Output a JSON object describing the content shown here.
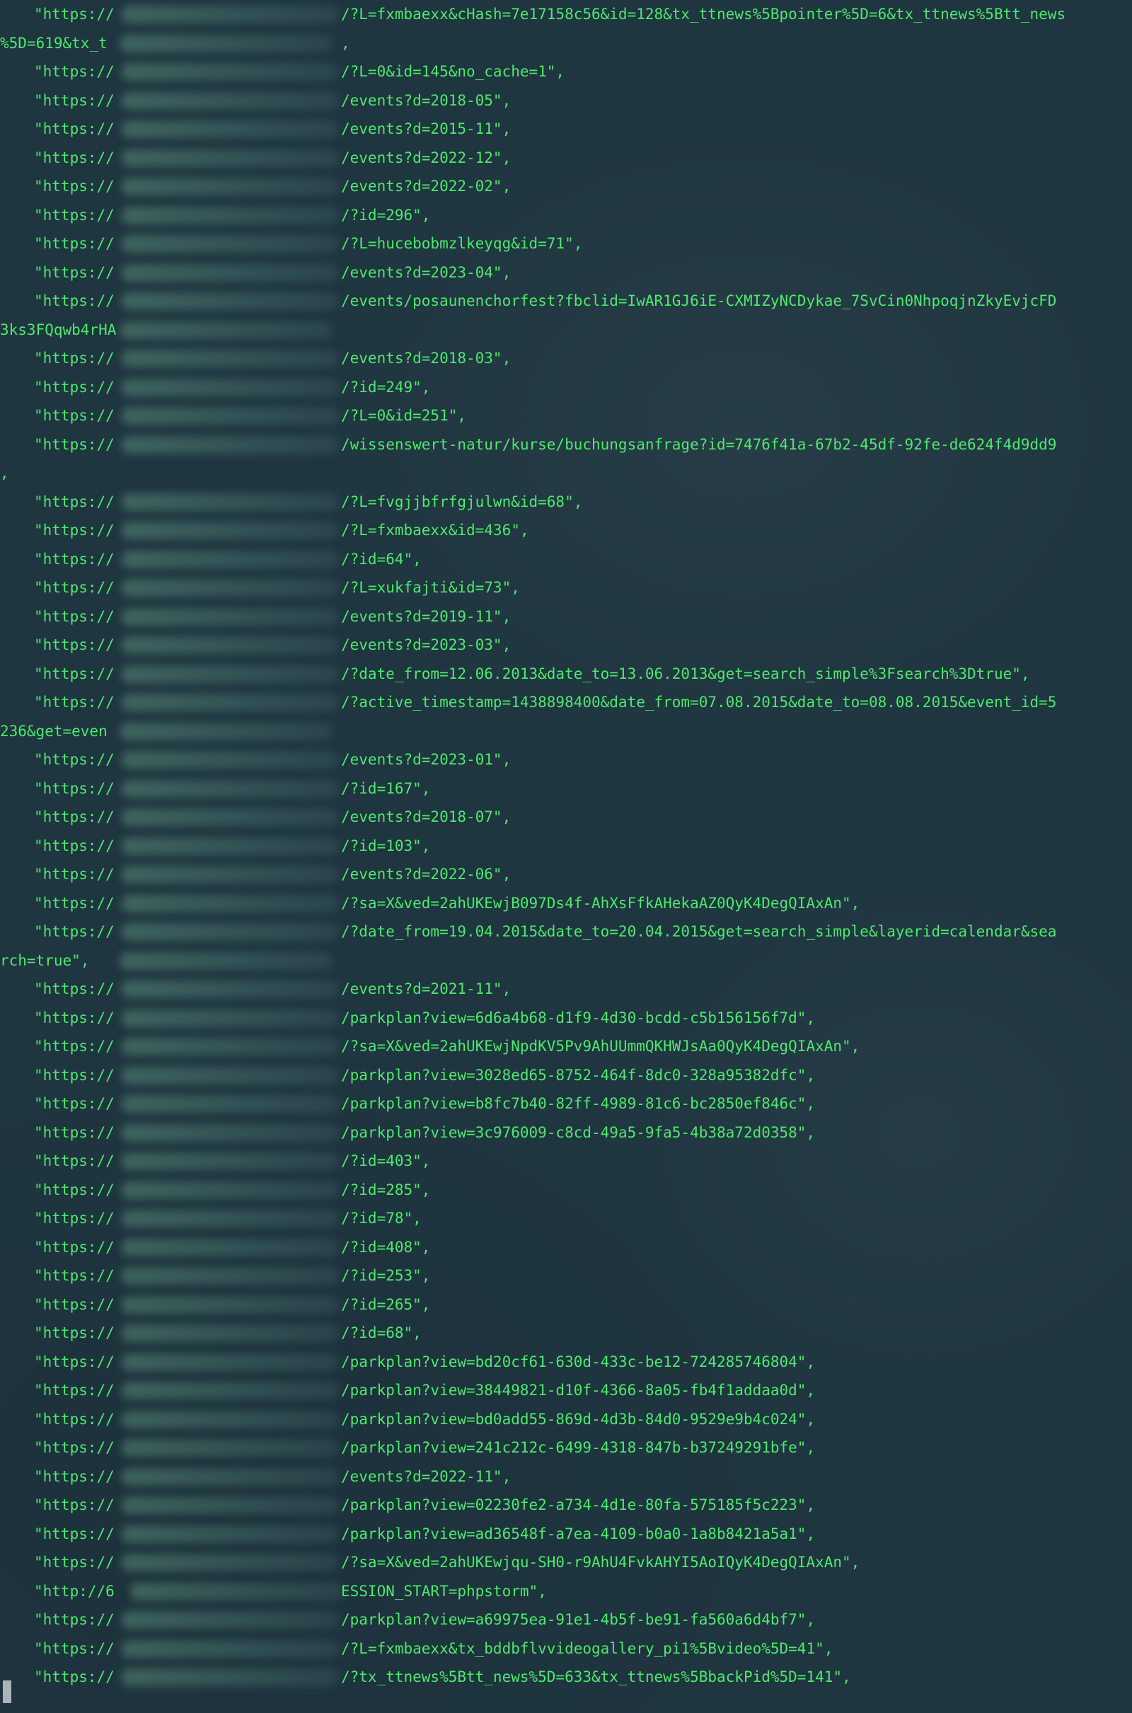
{
  "terminal": {
    "lines": [
      {
        "prefix": "\"https://",
        "path": "/?L=fxmbaexx&cHash=7e17158c56&id=128&tx_ttnews%5Bpointer%5D=6&tx_ttnews%5Btt_news"
      },
      {
        "tail": "%5D=619&tx_t",
        "tail_end": ","
      },
      {
        "prefix": "\"https://",
        "path": "/?L=0&id=145&no_cache=1\","
      },
      {
        "prefix": "\"https://",
        "path": "/events?d=2018-05\","
      },
      {
        "prefix": "\"https://",
        "path": "/events?d=2015-11\","
      },
      {
        "prefix": "\"https://",
        "path": "/events?d=2022-12\","
      },
      {
        "prefix": "\"https://",
        "path": "/events?d=2022-02\","
      },
      {
        "prefix": "\"https://",
        "path": "/?id=296\","
      },
      {
        "prefix": "\"https://",
        "path": "/?L=hucebobmzlkeyqg&id=71\","
      },
      {
        "prefix": "\"https://",
        "path": "/events?d=2023-04\","
      },
      {
        "prefix": "\"https://",
        "path": "/events/posaunenchorfest?fbclid=IwAR1GJ6iE-CXMIZyNCDykae_7SvCin0NhpoqjnZkyEvjcFD"
      },
      {
        "tail": "3ks3FQqwb4rHA",
        "tail_end": ""
      },
      {
        "prefix": "\"https://",
        "path": "/events?d=2018-03\","
      },
      {
        "prefix": "\"https://",
        "path": "/?id=249\","
      },
      {
        "prefix": "\"https://",
        "path": "/?L=0&id=251\","
      },
      {
        "prefix": "\"https://",
        "path": "/wissenswert-natur/kurse/buchungsanfrage?id=7476f41a-67b2-45df-92fe-de624f4d9dd9"
      },
      {
        "tail": ",",
        "tail_end": ""
      },
      {
        "prefix": "\"https://",
        "path": "/?L=fvgjjbfrfgjulwn&id=68\","
      },
      {
        "prefix": "\"https://",
        "path": "/?L=fxmbaexx&id=436\","
      },
      {
        "prefix": "\"https://",
        "path": "/?id=64\","
      },
      {
        "prefix": "\"https://",
        "path": "/?L=xukfajti&id=73\","
      },
      {
        "prefix": "\"https://",
        "path": "/events?d=2019-11\","
      },
      {
        "prefix": "\"https://",
        "path": "/events?d=2023-03\","
      },
      {
        "prefix": "\"https://",
        "path": "/?date_from=12.06.2013&date_to=13.06.2013&get=search_simple%3Fsearch%3Dtrue\","
      },
      {
        "prefix": "\"https://",
        "path": "/?active_timestamp=1438898400&date_from=07.08.2015&date_to=08.08.2015&event_id=5"
      },
      {
        "tail": "236&get=even",
        "tail_end": ""
      },
      {
        "prefix": "\"https://",
        "path": "/events?d=2023-01\","
      },
      {
        "prefix": "\"https://",
        "path": "/?id=167\","
      },
      {
        "prefix": "\"https://",
        "path": "/events?d=2018-07\","
      },
      {
        "prefix": "\"https://",
        "path": "/?id=103\","
      },
      {
        "prefix": "\"https://",
        "path": "/events?d=2022-06\","
      },
      {
        "prefix": "\"https://",
        "path": "/?sa=X&ved=2ahUKEwjB097Ds4f-AhXsFfkAHekaAZ0QyK4DegQIAxAn\","
      },
      {
        "prefix": "\"https://",
        "path": "/?date_from=19.04.2015&date_to=20.04.2015&get=search_simple&layerid=calendar&sea"
      },
      {
        "tail": "rch=true\",",
        "tail_end": ""
      },
      {
        "prefix": "\"https://",
        "path": "/events?d=2021-11\","
      },
      {
        "prefix": "\"https://",
        "path": "/parkplan?view=6d6a4b68-d1f9-4d30-bcdd-c5b156156f7d\","
      },
      {
        "prefix": "\"https://",
        "path": "/?sa=X&ved=2ahUKEwjNpdKV5Pv9AhUUmmQKHWJsAa0QyK4DegQIAxAn\","
      },
      {
        "prefix": "\"https://",
        "path": "/parkplan?view=3028ed65-8752-464f-8dc0-328a95382dfc\","
      },
      {
        "prefix": "\"https://",
        "path": "/parkplan?view=b8fc7b40-82ff-4989-81c6-bc2850ef846c\","
      },
      {
        "prefix": "\"https://",
        "path": "/parkplan?view=3c976009-c8cd-49a5-9fa5-4b38a72d0358\","
      },
      {
        "prefix": "\"https://",
        "path": "/?id=403\","
      },
      {
        "prefix": "\"https://",
        "path": "/?id=285\","
      },
      {
        "prefix": "\"https://",
        "path": "/?id=78\","
      },
      {
        "prefix": "\"https://",
        "path": "/?id=408\","
      },
      {
        "prefix": "\"https://",
        "path": "/?id=253\","
      },
      {
        "prefix": "\"https://",
        "path": "/?id=265\","
      },
      {
        "prefix": "\"https://",
        "path": "/?id=68\","
      },
      {
        "prefix": "\"https://",
        "path": "/parkplan?view=bd20cf61-630d-433c-be12-724285746804\","
      },
      {
        "prefix": "\"https://",
        "path": "/parkplan?view=38449821-d10f-4366-8a05-fb4f1addaa0d\","
      },
      {
        "prefix": "\"https://",
        "path": "/parkplan?view=bd0add55-869d-4d3b-84d0-9529e9b4c024\","
      },
      {
        "prefix": "\"https://",
        "path": "/parkplan?view=241c212c-6499-4318-847b-b37249291bfe\","
      },
      {
        "prefix": "\"https://",
        "path": "/events?d=2022-11\","
      },
      {
        "prefix": "\"https://",
        "path": "/parkplan?view=02230fe2-a734-4d1e-80fa-575185f5c223\","
      },
      {
        "prefix": "\"https://",
        "path": "/parkplan?view=ad36548f-a7ea-4109-b0a0-1a8b8421a5a1\","
      },
      {
        "prefix": "\"https://",
        "path": "/?sa=X&ved=2ahUKEwjqu-SH0-r9AhU4FvkAHYI5AoIQyK4DegQIAxAn\","
      },
      {
        "prefix": "\"http://6",
        "path": "ESSION_START=phpstorm\",",
        "ip": true
      },
      {
        "prefix": "\"https://",
        "path": "/parkplan?view=a69975ea-91e1-4b5f-be91-fa560a6d4bf7\","
      },
      {
        "prefix": "\"https://",
        "path": "/?L=fxmbaexx&tx_bddbflvvideogallery_pi1%5Bvideo%5D=41\","
      },
      {
        "prefix": "\"https://",
        "path": "/?tx_ttnews%5Btt_news%5D=633&tx_ttnews%5BbackPid%5D=141\","
      }
    ]
  }
}
